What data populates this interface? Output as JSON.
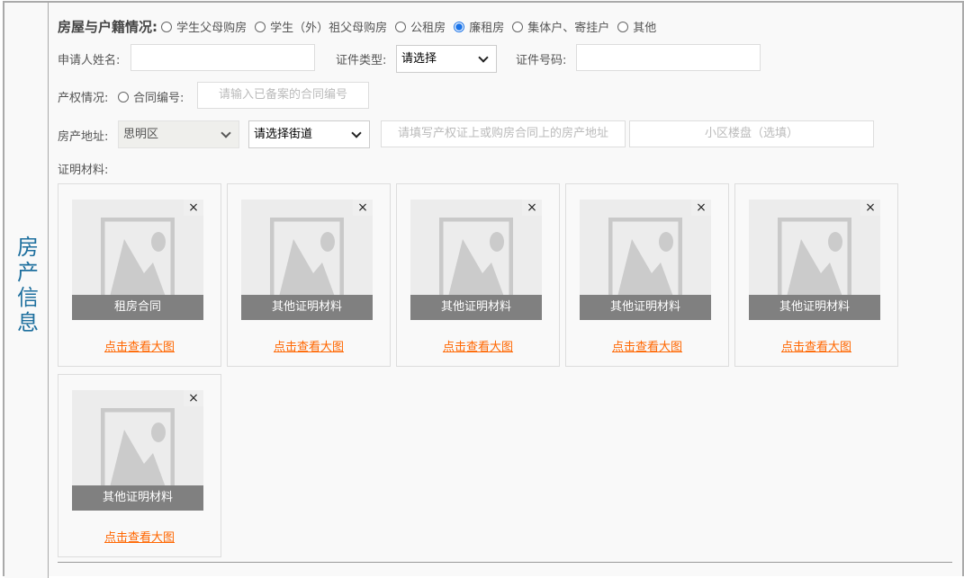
{
  "section_title": "房产信息",
  "housing": {
    "label": "房屋与户籍情况:",
    "options": [
      {
        "label": "学生父母购房",
        "checked": false
      },
      {
        "label": "学生（外）祖父母购房",
        "checked": false
      },
      {
        "label": "公租房",
        "checked": false
      },
      {
        "label": "廉租房",
        "checked": true
      },
      {
        "label": "集体户、寄挂户",
        "checked": false
      },
      {
        "label": "其他",
        "checked": false
      }
    ]
  },
  "applicant": {
    "name_label": "申请人姓名:",
    "name_value": "",
    "id_type_label": "证件类型:",
    "id_type_value": "请选择",
    "id_no_label": "证件号码:",
    "id_no_value": ""
  },
  "property": {
    "label": "产权情况:",
    "contract_label": "合同编号:",
    "contract_placeholder": "请输入已备案的合同编号"
  },
  "address": {
    "label": "房产地址:",
    "district": "思明区",
    "street": "请选择街道",
    "address_placeholder": "请填写产权证上或购房合同上的房产地址",
    "community_placeholder": "小区楼盘（选填）"
  },
  "materials": {
    "label": "证明材料:",
    "close": "×",
    "link": "点击查看大图",
    "items": [
      {
        "caption": "租房合同"
      },
      {
        "caption": "其他证明材料"
      },
      {
        "caption": "其他证明材料"
      },
      {
        "caption": "其他证明材料"
      },
      {
        "caption": "其他证明材料"
      },
      {
        "caption": "其他证明材料"
      }
    ]
  }
}
